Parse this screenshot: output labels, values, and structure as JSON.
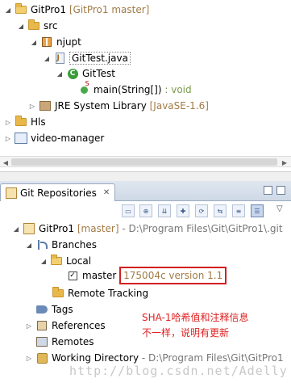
{
  "explorer": {
    "project": {
      "name": "GitPro1",
      "decoration": "[GitPro1 master]"
    },
    "src": "src",
    "package": "njupt",
    "file": "GitTest.java",
    "class": "GitTest",
    "method": {
      "name": "main(String[])",
      "return": ": void"
    },
    "jre": {
      "name": "JRE System Library",
      "decoration": "[JavaSE-1.6]"
    },
    "projects": [
      "Hls",
      "video-manager"
    ]
  },
  "view": {
    "title": "Git Repositories",
    "close_glyph": "✕"
  },
  "repos": {
    "root": {
      "name": "GitPro1",
      "branch": "[master]",
      "path": "- D:\\Program Files\\Git\\GitPro1\\.git"
    },
    "branches": "Branches",
    "local": "Local",
    "master": {
      "name": "master",
      "commit": "175004c version 1.1"
    },
    "remote_tracking": "Remote Tracking",
    "tags": "Tags",
    "references": "References",
    "remotes": "Remotes",
    "working_dir": {
      "name": "Working Directory",
      "path": "- D:\\Program Files\\Git\\GitPro1"
    }
  },
  "annotation": {
    "line1": "SHA-1哈希值和注释信息",
    "line2": "不一样，说明有更新"
  },
  "watermark": "http://blog.csdn.net/Adelly",
  "colors": {
    "highlight": "#d32020",
    "decoration": "#a27b47",
    "note": "#e02020"
  }
}
